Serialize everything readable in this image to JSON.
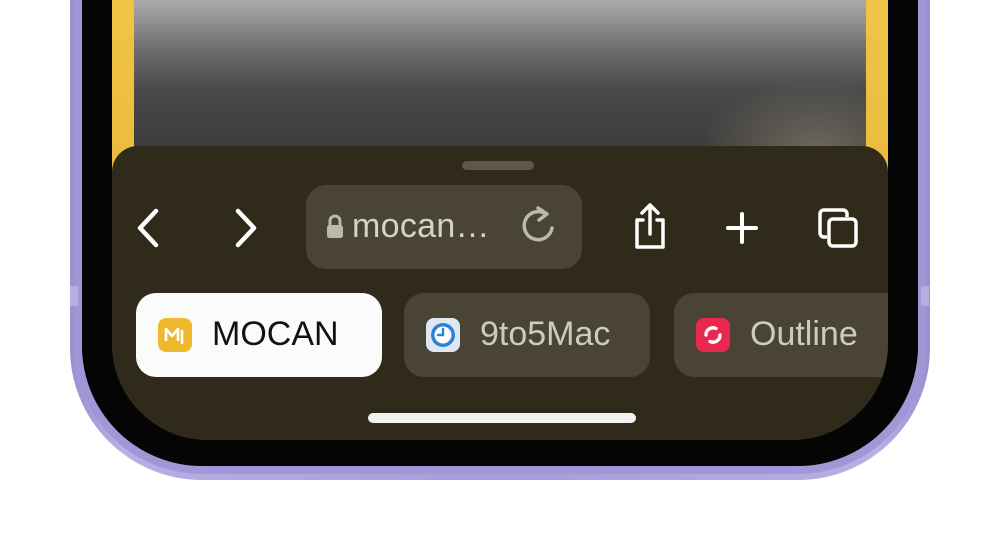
{
  "browser": {
    "address_bar": {
      "url_display": "mocan…",
      "secure": true
    },
    "toolbar": {
      "back": "chevron-left-icon",
      "forward": "chevron-right-icon",
      "share": "share-icon",
      "new_tab": "plus-icon",
      "tabs": "tabs-icon"
    },
    "tab_groups": [
      {
        "label": "MOCAN",
        "icon": "mocan-logo-icon",
        "active": true
      },
      {
        "label": "9to5Mac",
        "icon": "9to5mac-clock-icon",
        "active": false
      },
      {
        "label": "Outline",
        "icon": "outline-logo-icon",
        "active": false
      }
    ]
  },
  "colors": {
    "toolbar_bg": "#302a1b",
    "control_bg": "#4a4434",
    "active_chip_bg": "#fbfbfb",
    "frame": "#a89cd8",
    "mocan_icon": "#f0b82c",
    "ninetofive_icon": "#2f80d8",
    "outline_icon": "#e8284f"
  }
}
